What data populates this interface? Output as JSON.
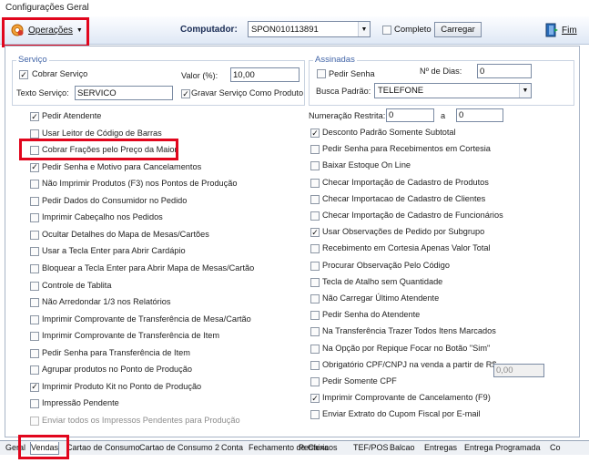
{
  "window": {
    "title": "Configurações Geral"
  },
  "toolbar": {
    "operations_label": "Operações",
    "computer_label": "Computador:",
    "computer_value": "SPON010113891",
    "complete_label": "Completo",
    "load_label": "Carregar",
    "exit_label": "Fim"
  },
  "service": {
    "title": "Serviço",
    "charge_label": "Cobrar Serviço",
    "value_label": "Valor (%):",
    "value": "10,00",
    "text_label": "Texto Serviço:",
    "text_value": "SERVICO",
    "save_label": "Gravar Serviço Como Produto"
  },
  "subscriptions": {
    "title": "Assinadas",
    "ask_password_label": "Pedir Senha",
    "days_label": "Nº de Dias:",
    "days_value": "0",
    "search_label": "Busca Padrão:",
    "search_value": "TELEFONE"
  },
  "restricted": {
    "label": "Numeração Restrita:",
    "from": "0",
    "sep": "a",
    "to": "0"
  },
  "left_options": [
    {
      "label": "Pedir Atendente",
      "checked": true
    },
    {
      "label": "Usar Leitor de Código de Barras",
      "checked": false
    },
    {
      "label": "Cobrar Frações pelo Preço da Maior",
      "checked": false
    },
    {
      "label": "Pedir Senha e Motivo para Cancelamentos",
      "checked": true
    },
    {
      "label": "Não Imprimir Produtos (F3) nos Pontos de Produção",
      "checked": false
    },
    {
      "label": "Pedir Dados do Consumidor no Pedido",
      "checked": false
    },
    {
      "label": "Imprimir Cabeçalho nos Pedidos",
      "checked": false
    },
    {
      "label": "Ocultar Detalhes do Mapa de Mesas/Cartões",
      "checked": false
    },
    {
      "label": "Usar a Tecla Enter para Abrir Cardápio",
      "checked": false
    },
    {
      "label": "Bloquear a Tecla Enter para Abrir Mapa de Mesas/Cartão",
      "checked": false
    },
    {
      "label": "Controle de Tablita",
      "checked": false
    },
    {
      "label": "Não Arredondar 1/3 nos Relatórios",
      "checked": false
    },
    {
      "label": "Imprimir Comprovante de Transferência de Mesa/Cartão",
      "checked": false
    },
    {
      "label": "Imprimir Comprovante de Transferência de Item",
      "checked": false
    },
    {
      "label": "Pedir Senha para Transferência de Item",
      "checked": false
    },
    {
      "label": "Agrupar produtos no Ponto de Produção",
      "checked": false
    },
    {
      "label": "Imprimir Produto Kit no Ponto de Produção",
      "checked": true
    },
    {
      "label": "Impressão Pendente",
      "checked": false
    },
    {
      "label": "Enviar todos os Impressos Pendentes para Produção",
      "checked": false,
      "disabled": true
    }
  ],
  "right_options": [
    {
      "label": "Desconto Padrão Somente Subtotal",
      "checked": true
    },
    {
      "label": "Pedir Senha para Recebimentos em Cortesia",
      "checked": false
    },
    {
      "label": "Baixar Estoque On Line",
      "checked": false
    },
    {
      "label": "Checar Importação de Cadastro de Produtos",
      "checked": false
    },
    {
      "label": "Checar Importacao de Cadastro de Clientes",
      "checked": false
    },
    {
      "label": "Checar Importação de Cadastro de Funcionários",
      "checked": false
    },
    {
      "label": "Usar Observações de Pedido por Subgrupo",
      "checked": true
    },
    {
      "label": "Recebimento em Cortesia Apenas Valor Total",
      "checked": false
    },
    {
      "label": "Procurar Observação Pelo Código",
      "checked": false
    },
    {
      "label": "Tecla de Atalho sem Quantidade",
      "checked": false
    },
    {
      "label": "Não Carregar Último Atendente",
      "checked": false
    },
    {
      "label": "Pedir Senha do Atendente",
      "checked": false
    },
    {
      "label": "Na Transferência Trazer Todos Itens Marcados",
      "checked": false
    },
    {
      "label": "Na Opção por Repique Focar no Botão \"Sim\"",
      "checked": false
    },
    {
      "label": "Obrigatório CPF/CNPJ na venda a partir de R$",
      "checked": false
    },
    {
      "label": "Pedir Somente CPF",
      "checked": false
    },
    {
      "label": "Imprimir Comprovante de Cancelamento (F9)",
      "checked": true
    },
    {
      "label": "Enviar Extrato do Cupom Fiscal por E-mail",
      "checked": false
    }
  ],
  "cpf_min_value": "0,00",
  "tabs": [
    "Geral",
    "Vendas",
    "Cartao de Consumo",
    "Cartao de Consumo 2",
    "Conta",
    "Fechamento de Caixa",
    "Perifericos",
    "TEF/POS",
    "Balcao",
    "Entregas",
    "Entrega Programada",
    "Co"
  ]
}
